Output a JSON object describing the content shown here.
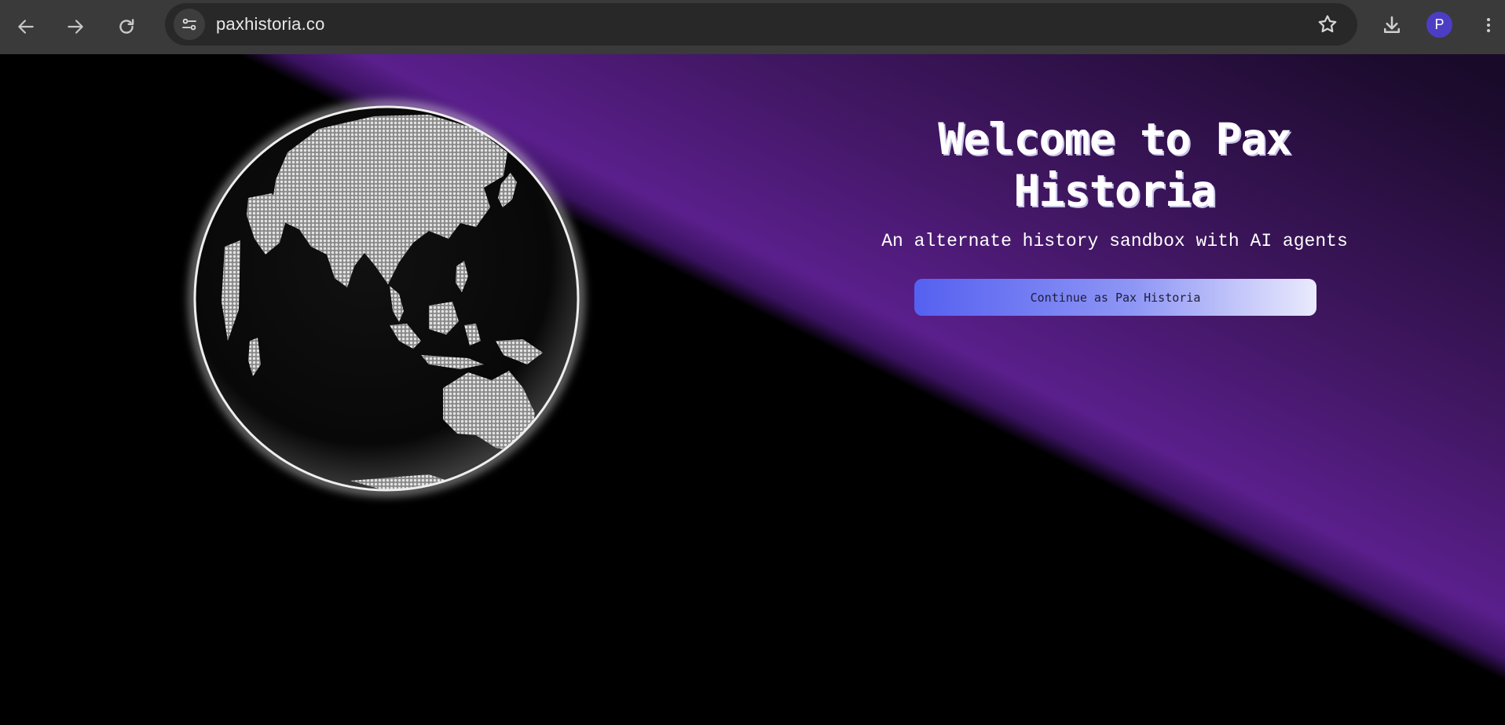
{
  "browser": {
    "url": "paxhistoria.co",
    "avatar_letter": "P",
    "icons": {
      "back": "arrow-left-icon",
      "forward": "arrow-right-icon",
      "reload": "reload-icon",
      "site_info": "tune-icon",
      "bookmark": "star-icon",
      "download": "download-icon",
      "menu": "kebab-menu-icon"
    }
  },
  "hero": {
    "title": "Welcome to Pax Historia",
    "subtitle": "An alternate history sandbox with AI agents",
    "continue_label": "Continue as Pax Historia"
  },
  "colors": {
    "accent_purple": "#5a1f8c",
    "button_start": "#5560f0",
    "button_end": "#eaeafd",
    "avatar": "#4c3ec4"
  },
  "globe": {
    "icon": "earth-globe-illustration"
  }
}
